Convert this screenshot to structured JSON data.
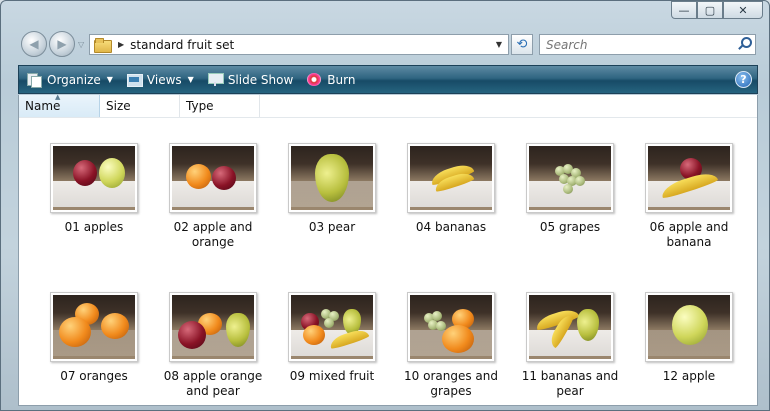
{
  "window": {
    "minimize_glyph": "—",
    "maximize_glyph": "▢",
    "close_glyph": "✕"
  },
  "navigation": {
    "back_glyph": "◀",
    "forward_glyph": "▶",
    "recent_glyph": "▽"
  },
  "address_bar": {
    "separator_glyph": "▶",
    "path": "standard fruit set",
    "dropdown_glyph": "▼",
    "refresh_glyph": "⟲"
  },
  "search": {
    "placeholder": "Search"
  },
  "toolbar": {
    "organize_label": "Organize",
    "views_label": "Views",
    "slideshow_label": "Slide Show",
    "burn_label": "Burn",
    "caret_glyph": "▼",
    "help_glyph": "?"
  },
  "columns": {
    "sort_arrow": "▲",
    "name": "Name",
    "size": "Size",
    "type": "Type"
  },
  "files": [
    {
      "line1": "01 apples",
      "line2": ""
    },
    {
      "line1": "02 apple and",
      "line2": "orange"
    },
    {
      "line1": "03 pear",
      "line2": ""
    },
    {
      "line1": "04 bananas",
      "line2": ""
    },
    {
      "line1": "05 grapes",
      "line2": ""
    },
    {
      "line1": "06 apple and",
      "line2": "banana"
    },
    {
      "line1": "07 oranges",
      "line2": ""
    },
    {
      "line1": "08 apple orange",
      "line2": "and pear"
    },
    {
      "line1": "09 mixed fruit",
      "line2": ""
    },
    {
      "line1": "10 oranges and",
      "line2": "grapes"
    },
    {
      "line1": "11 bananas and",
      "line2": "pear"
    },
    {
      "line1": "12 apple",
      "line2": ""
    }
  ],
  "colors": {
    "toolbar_dark": "#174b66",
    "toolbar_light": "#5e8aa3",
    "selected_column": "#d9ebf7"
  }
}
